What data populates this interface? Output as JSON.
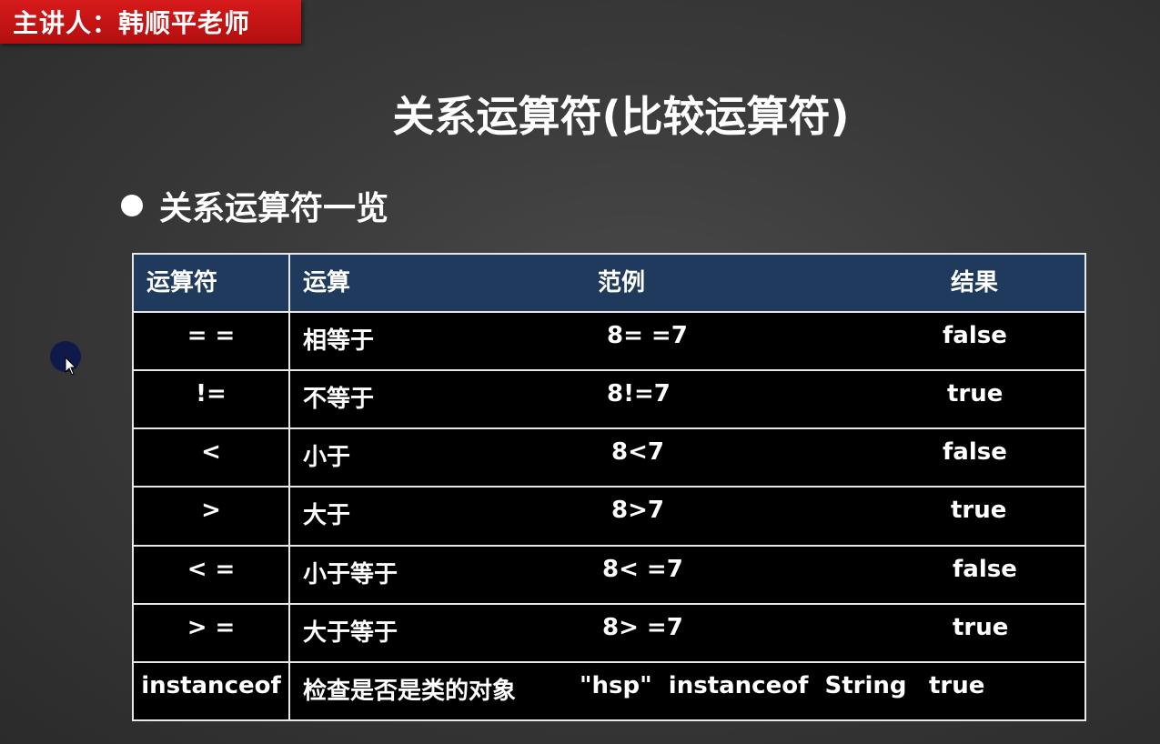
{
  "badge": "主讲人：韩顺平老师",
  "title": "关系运算符(比较运算符)",
  "section_heading": "关系运算符一览",
  "table": {
    "headers": {
      "operator": "运算符",
      "operation": "运算",
      "example": "范例",
      "result": "结果"
    },
    "rows": [
      {
        "operator": "= =",
        "operation": "相等于",
        "example": "8= =7",
        "result": "false"
      },
      {
        "operator": "!=",
        "operation": "不等于",
        "example": "8!=7",
        "result": "true"
      },
      {
        "operator": "<",
        "operation": "小于",
        "example": "8<7",
        "result": "false"
      },
      {
        "operator": ">",
        "operation": "大于",
        "example": "8>7",
        "result": "true"
      },
      {
        "operator": "< =",
        "operation": "小于等于",
        "example": "8< =7",
        "result": "false"
      },
      {
        "operator": "> =",
        "operation": "大于等于",
        "example": "8> =7",
        "result": "true"
      },
      {
        "operator": "instanceof",
        "operation": "检查是否是类的对象",
        "example": "\"hsp\"  instanceof  String",
        "result": "true"
      }
    ]
  }
}
